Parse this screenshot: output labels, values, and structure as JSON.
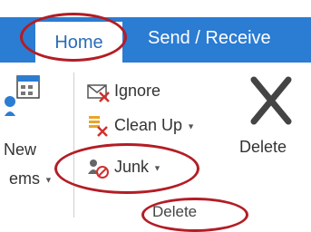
{
  "tabs": [
    {
      "label": "Home"
    },
    {
      "label": "Send / Receive"
    }
  ],
  "new_items": {
    "line1": "New",
    "line2": "ems"
  },
  "delete_group": {
    "ignore_label": "Ignore",
    "cleanup_label": "Clean Up",
    "junk_label": "Junk",
    "delete_label": "Delete",
    "group_label": "Delete"
  },
  "icons": {
    "ignore": "ignore-mail-icon",
    "cleanup": "cleanup-icon",
    "junk": "junk-icon",
    "delete": "delete-x-icon",
    "new_items": "new-items-icon"
  },
  "colors": {
    "tab_strip": "#2b7cd3",
    "highlight_ring": "#b31d25",
    "delete_x": "#444444"
  }
}
